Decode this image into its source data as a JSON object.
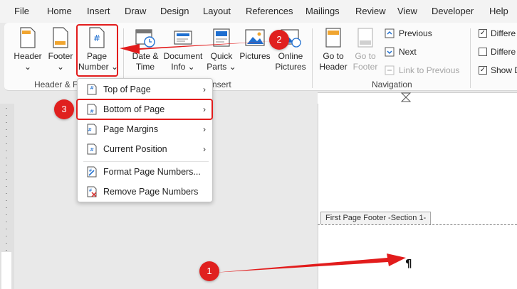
{
  "tabs": [
    "File",
    "Home",
    "Insert",
    "Draw",
    "Design",
    "Layout",
    "References",
    "Mailings",
    "Review",
    "View",
    "Developer",
    "Help"
  ],
  "ribbon": {
    "header_btn": [
      "Header",
      "⌄"
    ],
    "footer_btn": [
      "Footer",
      "⌄"
    ],
    "page_number_btn": [
      "Page",
      "Number ⌄"
    ],
    "date_time_btn": [
      "Date &",
      "Time"
    ],
    "document_info_btn": [
      "Document",
      "Info ⌄"
    ],
    "quick_parts_btn": [
      "Quick",
      "Parts ⌄"
    ],
    "pictures_btn": "Pictures",
    "online_pictures_btn": [
      "Online",
      "Pictures"
    ],
    "go_to_header_btn": [
      "Go to",
      "Header"
    ],
    "go_to_footer_btn": [
      "Go to",
      "Footer"
    ],
    "previous": "Previous",
    "next": "Next",
    "link_to_previous": "Link to Previous",
    "group_header_footer": "Header & F",
    "group_insert": "nsert",
    "group_navigation": "Navigation",
    "option1": "Differe",
    "option2": "Differe",
    "option3": "Show D"
  },
  "dropdown": {
    "items": [
      {
        "label": "Top of Page",
        "submenu": "›"
      },
      {
        "label": "Bottom of Page",
        "submenu": "›"
      },
      {
        "label": "Page Margins",
        "submenu": "›"
      },
      {
        "label": "Current Position",
        "submenu": "›"
      },
      {
        "label": "Format Page Numbers..."
      },
      {
        "label": "Remove Page Numbers"
      }
    ]
  },
  "document": {
    "footer_tag": "First Page Footer -Section 1-",
    "pilcrow": "¶"
  },
  "annotations": {
    "badge1": "1",
    "badge2": "2",
    "badge3": "3",
    "color": "#e21c1c"
  }
}
